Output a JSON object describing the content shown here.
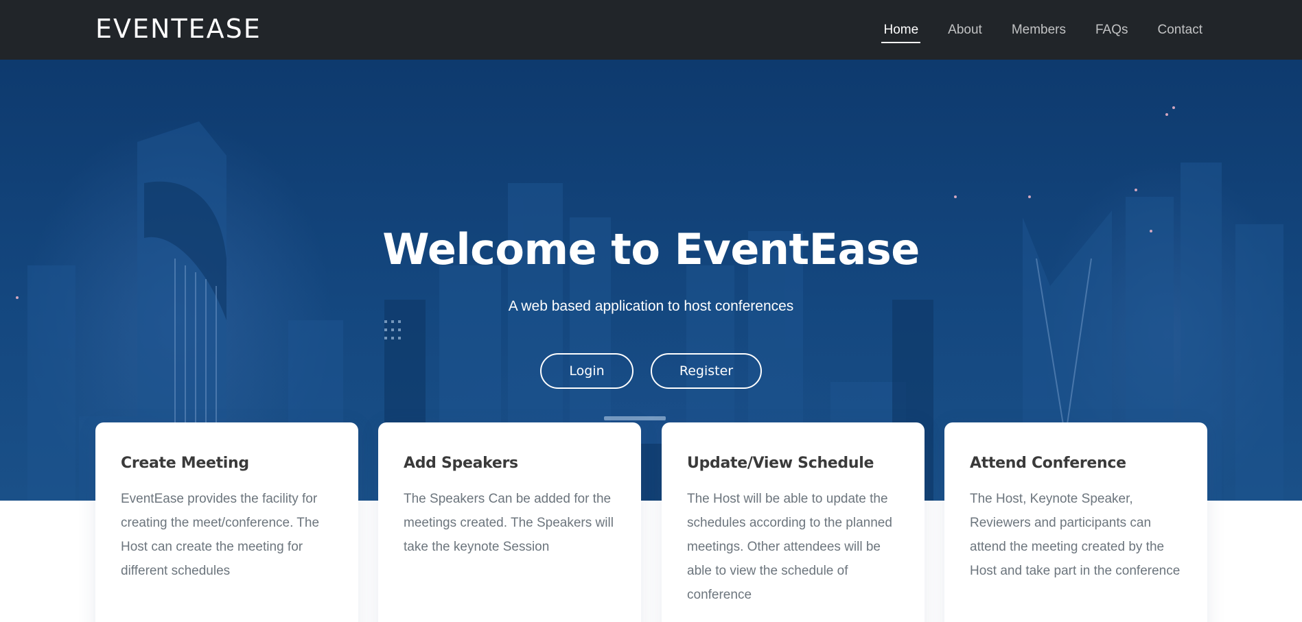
{
  "brand": "EVENTEASE",
  "nav": {
    "items": [
      {
        "label": "Home",
        "active": true
      },
      {
        "label": "About",
        "active": false
      },
      {
        "label": "Members",
        "active": false
      },
      {
        "label": "FAQs",
        "active": false
      },
      {
        "label": "Contact",
        "active": false
      }
    ]
  },
  "hero": {
    "title": "Welcome to EventEase",
    "subtitle": "A web based application to host conferences",
    "login_label": "Login",
    "register_label": "Register"
  },
  "features": [
    {
      "title": "Create Meeting",
      "text": "EventEase provides the facility for creating the meet/conference. The Host can create the meeting for different schedules"
    },
    {
      "title": "Add Speakers",
      "text": "The Speakers Can be added for the meetings created. The Speakers will take the keynote Session"
    },
    {
      "title": "Update/View Schedule",
      "text": "The Host will be able to update the schedules according to the planned meetings. Other attendees will be able to view the schedule of conference"
    },
    {
      "title": "Attend Conference",
      "text": "The Host, Keynote Speaker, Reviewers and participants can attend the meeting created by the Host and take part in the conference"
    }
  ],
  "colors": {
    "navbar": "#212529",
    "hero_overlay": "#11427a",
    "card_title": "#3a3a3a",
    "card_text": "#6c757d"
  }
}
